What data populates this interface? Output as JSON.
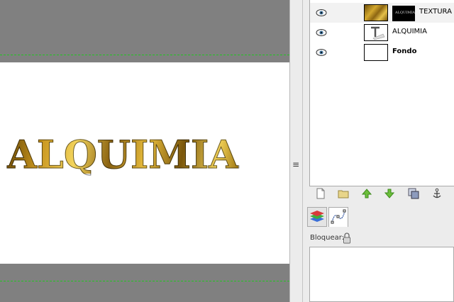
{
  "canvas": {
    "artwork_text": "ALQUIMIA",
    "guide_color": "#22c522",
    "background_color": "#808080"
  },
  "layers": [
    {
      "name": "TEXTURA",
      "visible": true,
      "bold": false,
      "has_mask": true,
      "mask_text": "ALQUIMIA",
      "thumb": "gold-texture"
    },
    {
      "name": "ALQUIMIA",
      "visible": true,
      "bold": false,
      "has_mask": false,
      "thumb": "text-layer"
    },
    {
      "name": "Fondo",
      "visible": true,
      "bold": true,
      "has_mask": false,
      "thumb": "white"
    }
  ],
  "layers_toolbar": [
    "new-layer-icon",
    "folder-icon",
    "raise-layer-icon",
    "lower-layer-icon",
    "duplicate-layer-icon",
    "anchor-icon"
  ],
  "dock": {
    "tabs": [
      "layers-stack-icon",
      "paths-icon"
    ],
    "lock_label": "Bloquear:"
  }
}
